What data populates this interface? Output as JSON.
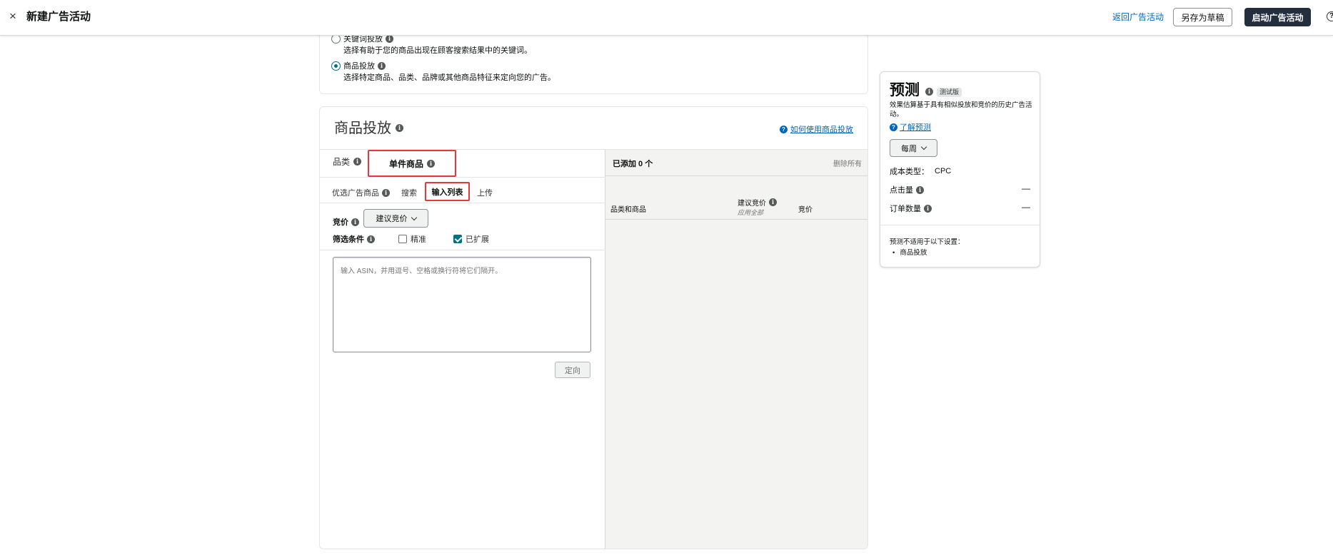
{
  "header": {
    "close_icon": "×",
    "title": "新建广告活动",
    "back_link": "返回广告活动",
    "save_draft": "另存为草稿",
    "launch": "启动广告活动",
    "help_icon": "?"
  },
  "targeting_type": {
    "keyword": {
      "label": "关键词投放",
      "desc": "选择有助于您的商品出现在顾客搜索结果中的关键词。",
      "selected": false
    },
    "product": {
      "label": "商品投放",
      "desc": "选择特定商品、品类、品牌或其他商品特征来定向您的广告。",
      "selected": true
    }
  },
  "product_targeting": {
    "title": "商品投放",
    "howto_link": "如何使用商品投放",
    "tabs": {
      "category": "品类",
      "individual": "单件商品"
    },
    "subtabs": {
      "suggested": "优选广告商品",
      "search": "搜索",
      "enter_list": "输入列表",
      "upload": "上传"
    },
    "bid_label": "竞价",
    "bid_select": "建议竞价",
    "filter_label": "筛选条件",
    "filter_exact": {
      "label": "精准",
      "checked": false
    },
    "filter_expanded": {
      "label": "已扩展",
      "checked": true
    },
    "asin_placeholder": "输入 ASIN，并用逗号、空格或换行符将它们隔开。",
    "target_button": "定向",
    "added": {
      "title": "已添加 0 个",
      "remove_all": "删除所有",
      "col_product": "品类和商品",
      "col_suggested_bid": "建议竞价",
      "col_apply_all": "应用全部",
      "col_bid": "竞价"
    }
  },
  "forecast": {
    "title": "预测",
    "badge": "测试版",
    "desc": "效果估算基于具有相似投放和竞价的历史广告活动。",
    "learn_link": "了解预测",
    "period": "每周",
    "cost_type_label": "成本类型：",
    "cost_type_value": "CPC",
    "clicks_label": "点击量",
    "clicks_value": "—",
    "orders_label": "订单数量",
    "orders_value": "—",
    "note": "预测不适用于以下设置：",
    "bullet": "商品投放"
  },
  "colors": {
    "accent": "#007185",
    "link": "#0066c0",
    "highlight": "#e4393c",
    "launch_bg": "#232f3e"
  }
}
